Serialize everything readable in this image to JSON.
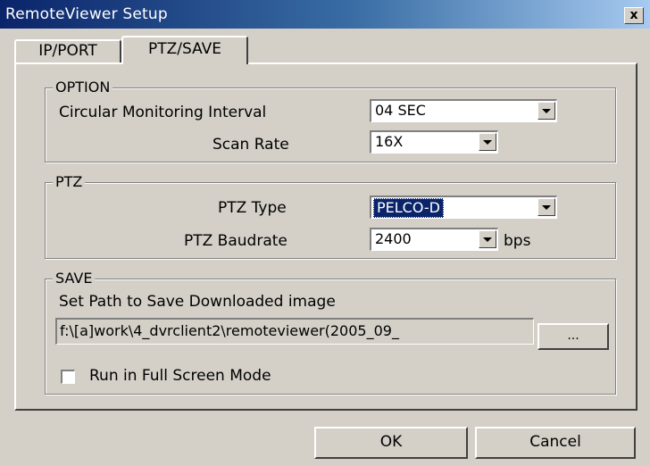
{
  "window": {
    "title": "RemoteViewer Setup",
    "close_label": "x"
  },
  "tabs": [
    {
      "label": "IP/PORT"
    },
    {
      "label": "PTZ/SAVE"
    }
  ],
  "option": {
    "legend": "OPTION",
    "interval_label": "Circular Monitoring Interval",
    "interval_value": "04 SEC",
    "scan_label": "Scan Rate",
    "scan_value": "16X"
  },
  "ptz": {
    "legend": "PTZ",
    "type_label": "PTZ Type",
    "type_value": "PELCO-D",
    "baud_label": "PTZ Baudrate",
    "baud_value": "2400",
    "baud_unit": "bps"
  },
  "save": {
    "legend": "SAVE",
    "path_label": "Set Path to Save Downloaded image",
    "path_value": "f:\\[a]work\\4_dvrclient2\\remoteviewer(2005_09_",
    "browse_label": "...",
    "fullscreen_label": "Run in Full Screen Mode",
    "fullscreen_checked": false
  },
  "buttons": {
    "ok": "OK",
    "cancel": "Cancel"
  }
}
